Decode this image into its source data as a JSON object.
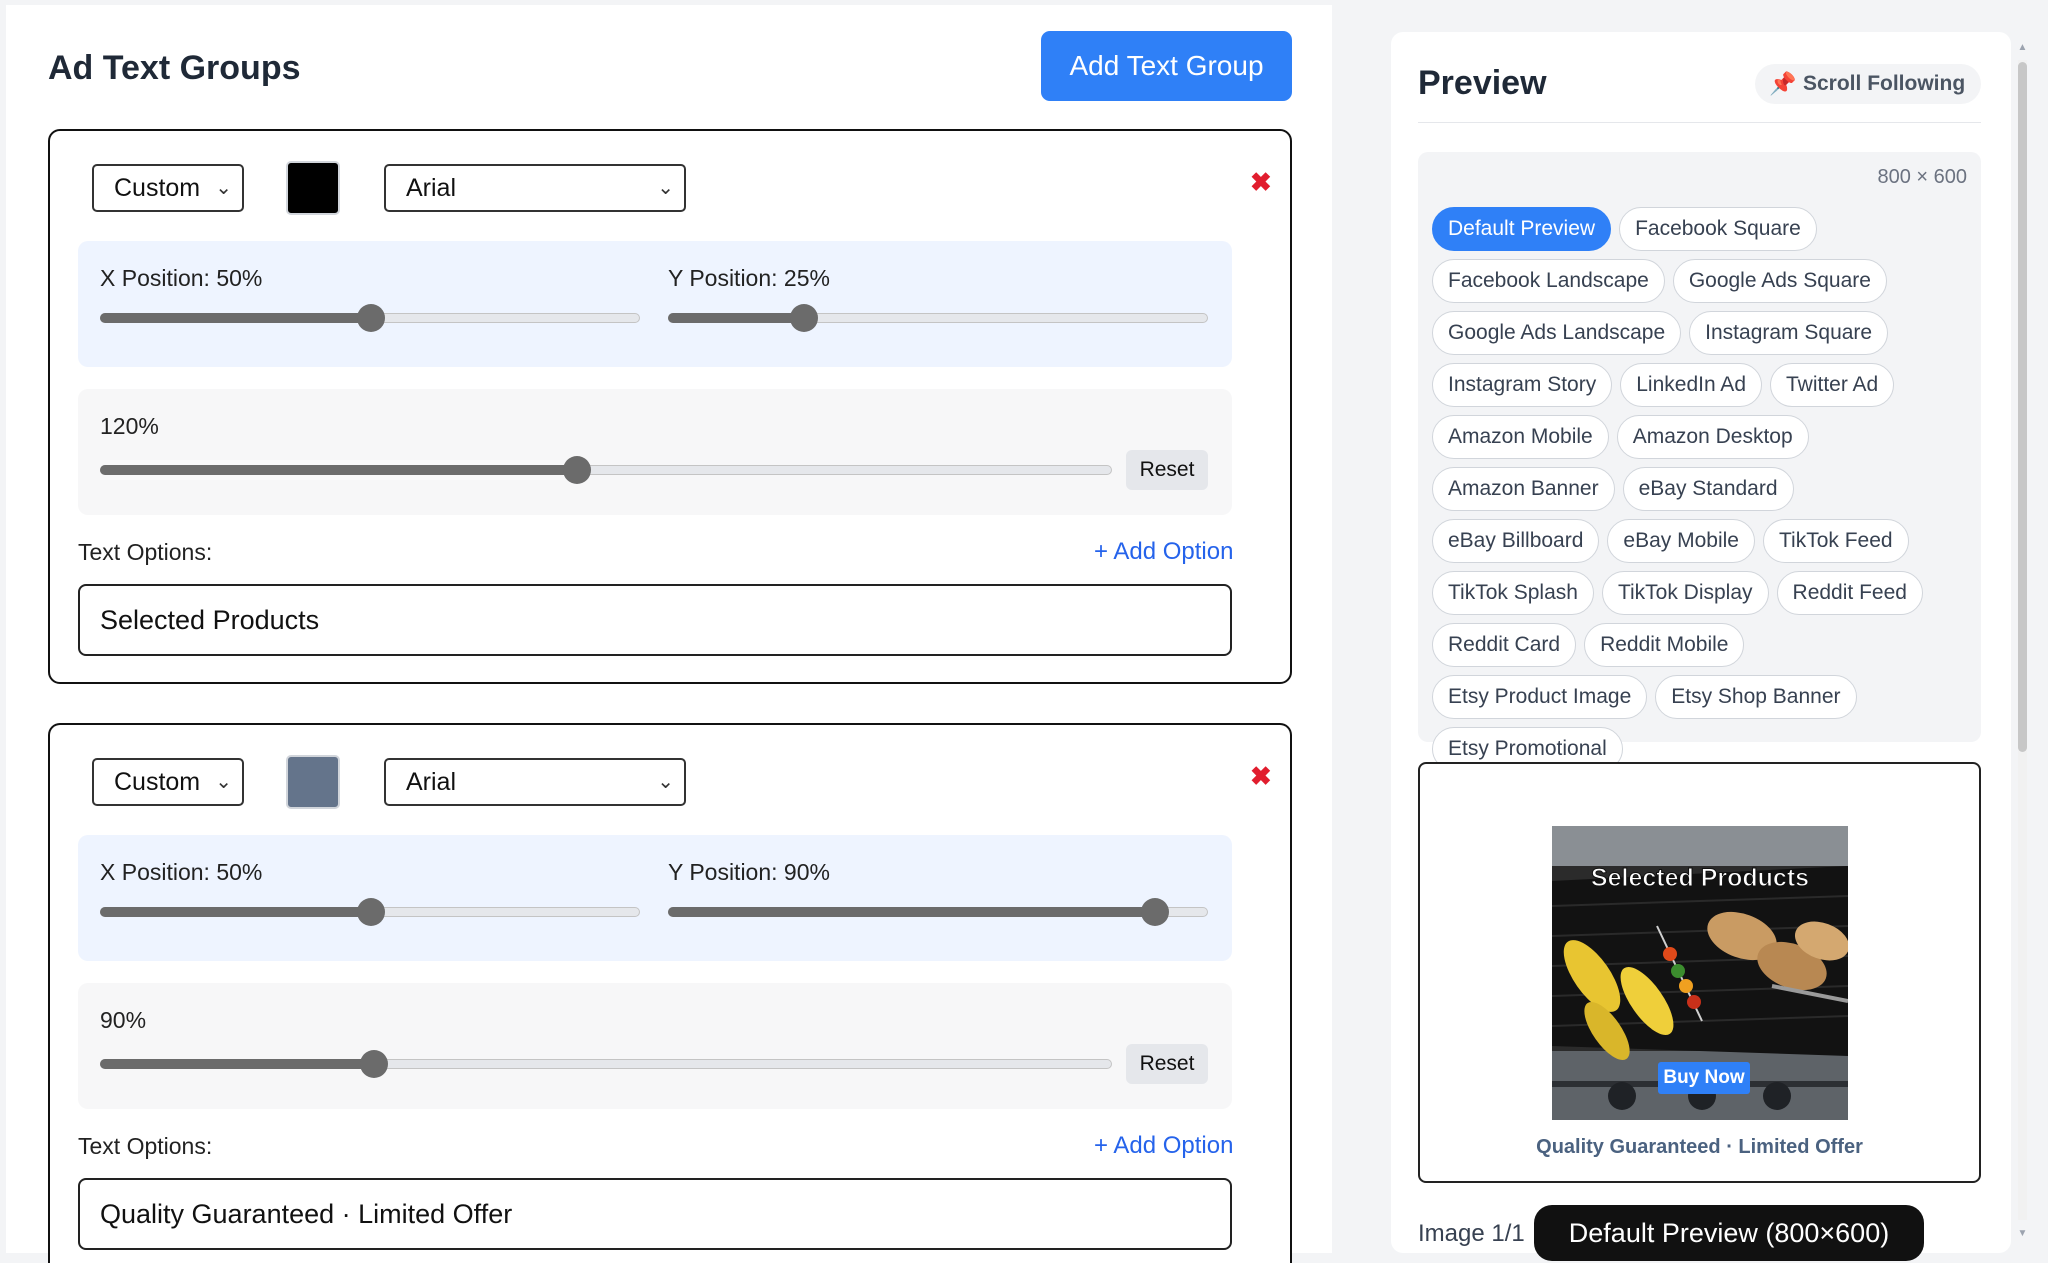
{
  "editor": {
    "title": "Ad Text Groups",
    "add_group_label": "Add Text Group",
    "groups": [
      {
        "style_select": "Custom",
        "color": "#000000",
        "font_select": "Arial",
        "x_label": "X Position: 50%",
        "x_value": 50,
        "y_label": "Y Position: 25%",
        "y_value": 25,
        "scale_label": "120%",
        "scale_fraction": 0.47,
        "reset_label": "Reset",
        "options_label": "Text Options:",
        "add_option_label": "+ Add Option",
        "text_value": "Selected Products"
      },
      {
        "style_select": "Custom",
        "color": "#64748b",
        "font_select": "Arial",
        "x_label": "X Position: 50%",
        "x_value": 50,
        "y_label": "Y Position: 90%",
        "y_value": 90,
        "scale_label": "90%",
        "scale_fraction": 0.27,
        "reset_label": "Reset",
        "options_label": "Text Options:",
        "add_option_label": "+ Add Option",
        "text_value": "Quality Guaranteed · Limited Offer"
      }
    ]
  },
  "preview": {
    "title": "Preview",
    "scroll_following_label": "Scroll Following",
    "dimensions": "800 × 600",
    "presets": [
      "Default Preview",
      "Facebook Square",
      "Facebook Landscape",
      "Google Ads Square",
      "Google Ads Landscape",
      "Instagram Square",
      "Instagram Story",
      "LinkedIn Ad",
      "Twitter Ad",
      "Amazon Mobile",
      "Amazon Desktop",
      "Amazon Banner",
      "eBay Standard",
      "eBay Billboard",
      "eBay Mobile",
      "TikTok Feed",
      "TikTok Splash",
      "TikTok Display",
      "Reddit Feed",
      "Reddit Card",
      "Reddit Mobile",
      "Etsy Product Image",
      "Etsy Shop Banner",
      "Etsy Promotional"
    ],
    "active_preset": "Default Preview",
    "ad_headline": "Selected Products",
    "ad_button": "Buy Now",
    "ad_caption": "Quality Guaranteed · Limited Offer",
    "image_counter": "Image 1/1",
    "image_label": "Default Preview (800×600)"
  },
  "colors": {
    "accent": "#2f80f7",
    "close": "#e11d2e",
    "link": "#2563eb"
  }
}
